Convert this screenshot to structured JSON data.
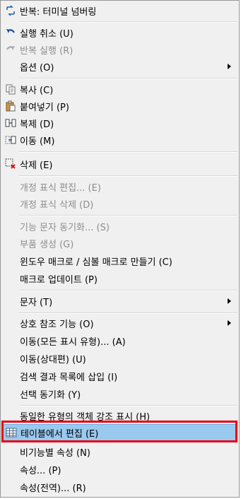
{
  "menu": {
    "items": [
      {
        "label": "반복: 터미널 넘버링",
        "icon": "repeat-icon",
        "enabled": true
      },
      {
        "label": "실행 취소 (U)",
        "icon": "undo-icon",
        "enabled": true
      },
      {
        "label": "반복 실행 (R)",
        "icon": "redo-icon",
        "enabled": false
      },
      {
        "label": "옵션 (O)",
        "icon": "",
        "enabled": true,
        "submenu": true
      },
      {
        "label": "복사 (C)",
        "icon": "copy-icon",
        "enabled": true
      },
      {
        "label": "붙여넣기 (P)",
        "icon": "paste-icon",
        "enabled": true
      },
      {
        "label": "복제 (D)",
        "icon": "duplicate-icon",
        "enabled": true
      },
      {
        "label": "이동 (M)",
        "icon": "move-icon",
        "enabled": true
      },
      {
        "label": "삭제 (E)",
        "icon": "delete-icon",
        "enabled": true
      },
      {
        "label": "개정 표식 편집... (E)",
        "icon": "",
        "enabled": false
      },
      {
        "label": "개정 표식 삭제 (D)",
        "icon": "",
        "enabled": false
      },
      {
        "label": "기능 문자 동기화... (S)",
        "icon": "",
        "enabled": false
      },
      {
        "label": "부품 생성 (G)",
        "icon": "",
        "enabled": false
      },
      {
        "label": "윈도우 매크로 / 심볼 매크로 만들기 (C)",
        "icon": "",
        "enabled": true
      },
      {
        "label": "매크로 업데이트 (P)",
        "icon": "",
        "enabled": true
      },
      {
        "label": "문자 (T)",
        "icon": "",
        "enabled": true,
        "submenu": true
      },
      {
        "label": "상호 참조 기능 (O)",
        "icon": "",
        "enabled": true,
        "submenu": true
      },
      {
        "label": "이동(모든 표시 유형)... (A)",
        "icon": "",
        "enabled": true
      },
      {
        "label": "이동(상대편) (U)",
        "icon": "",
        "enabled": true
      },
      {
        "label": "검색 결과 목록에 삽입 (I)",
        "icon": "",
        "enabled": true
      },
      {
        "label": "선택 동기화 (Y)",
        "icon": "",
        "enabled": true
      },
      {
        "label": "동일한 유형의 객체 강조 표시 (H)",
        "icon": "",
        "enabled": true
      },
      {
        "label": "테이블에서 편집 (E)",
        "icon": "table-icon",
        "enabled": true,
        "highlighted": true
      },
      {
        "label": "비기능별 속성 (N)",
        "icon": "",
        "enabled": true
      },
      {
        "label": "속성... (P)",
        "icon": "",
        "enabled": true
      },
      {
        "label": "속성(전역)... (R)",
        "icon": "",
        "enabled": true
      }
    ]
  },
  "colors": {
    "menu_bg": "#f0f0f0",
    "highlight_bg": "#99c9ef",
    "highlight_border": "#6daee6",
    "disabled_text": "#8d8d8d",
    "annotation_box": "#e8000b"
  }
}
